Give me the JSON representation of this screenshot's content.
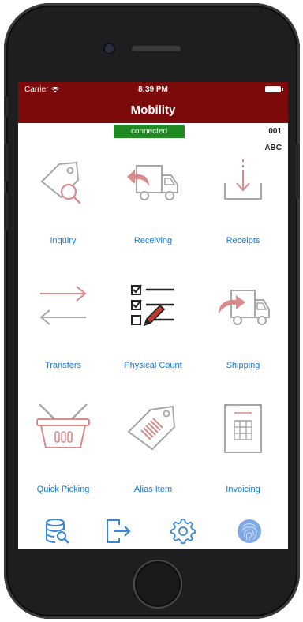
{
  "status_bar": {
    "carrier": "Carrier",
    "time": "8:39 PM"
  },
  "header": {
    "title": "Mobility"
  },
  "connection": {
    "status": "connected",
    "code": "001",
    "company": "ABC"
  },
  "tiles": [
    {
      "label": "Inquiry",
      "icon": "tag-search-icon"
    },
    {
      "label": "Receiving",
      "icon": "truck-arrow-back-icon"
    },
    {
      "label": "Receipts",
      "icon": "download-tray-icon"
    },
    {
      "label": "Transfers",
      "icon": "transfer-arrows-icon"
    },
    {
      "label": "Physical Count",
      "icon": "checklist-pencil-icon"
    },
    {
      "label": "Shipping",
      "icon": "truck-arrow-forward-icon"
    },
    {
      "label": "Quick Picking",
      "icon": "basket-icon"
    },
    {
      "label": "Alias Item",
      "icon": "barcode-tag-icon"
    },
    {
      "label": "Invoicing",
      "icon": "invoice-document-icon"
    }
  ],
  "tab_bar": {
    "icons": [
      "database-search-icon",
      "logout-icon",
      "settings-gear-icon",
      "fingerprint-icon"
    ]
  },
  "colors": {
    "header_bg": "#7d0a0a",
    "connected_bg": "#1e8a21",
    "label_blue": "#1a77d2",
    "icon_pink": "#d98b8b",
    "icon_gray": "#9a9a9a",
    "tab_blue": "#3a86d8"
  }
}
